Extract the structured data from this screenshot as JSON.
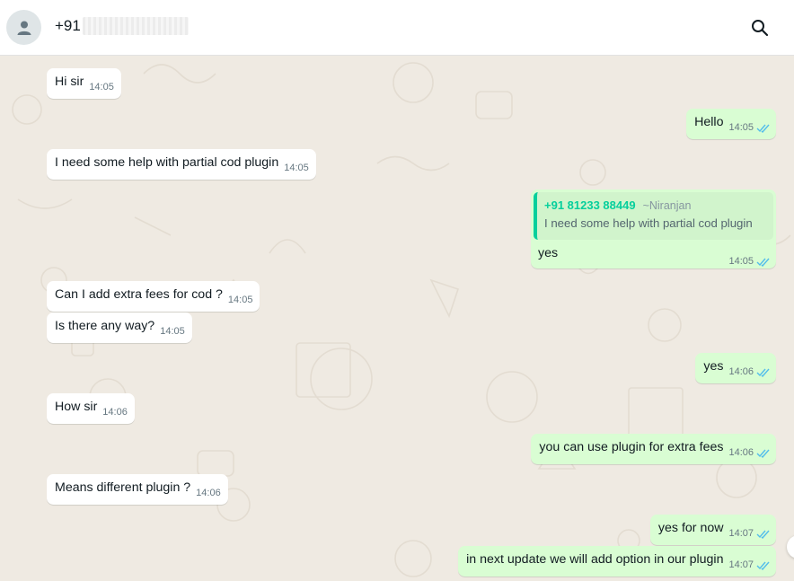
{
  "header": {
    "contact_prefix": "+91",
    "avatar_icon": "person-icon",
    "search_icon": "search-icon"
  },
  "colors": {
    "incoming_bubble": "#ffffff",
    "outgoing_bubble": "#d9fdd3",
    "chat_background": "#efeae2",
    "read_tick": "#53bdeb",
    "quote_accent": "#06cf9c"
  },
  "messages": [
    {
      "direction": "in",
      "text": "Hi sir",
      "time": "14:05"
    },
    {
      "direction": "out",
      "text": "Hello",
      "time": "14:05",
      "status": "read"
    },
    {
      "direction": "in",
      "text": "I need some help with partial cod plugin",
      "time": "14:05"
    },
    {
      "direction": "out",
      "text": "yes",
      "time": "14:05",
      "status": "read",
      "quote": {
        "sender": "+91 81233 88449",
        "sender_name": "~Niranjan",
        "text": "I need some help with partial cod plugin"
      }
    },
    {
      "direction": "in",
      "text": "Can I add extra fees for cod ?",
      "time": "14:05"
    },
    {
      "direction": "in",
      "text": "Is there any way?",
      "time": "14:05"
    },
    {
      "direction": "out",
      "text": "yes",
      "time": "14:06",
      "status": "read"
    },
    {
      "direction": "in",
      "text": "How sir",
      "time": "14:06"
    },
    {
      "direction": "out",
      "text": "you can use plugin for extra fees",
      "time": "14:06",
      "status": "read"
    },
    {
      "direction": "in",
      "text": "Means different plugin ?",
      "time": "14:06"
    },
    {
      "direction": "out",
      "text": "yes for now",
      "time": "14:07",
      "status": "read"
    },
    {
      "direction": "out",
      "text": "in next update we will add option in our plugin",
      "time": "14:07",
      "status": "read"
    }
  ]
}
